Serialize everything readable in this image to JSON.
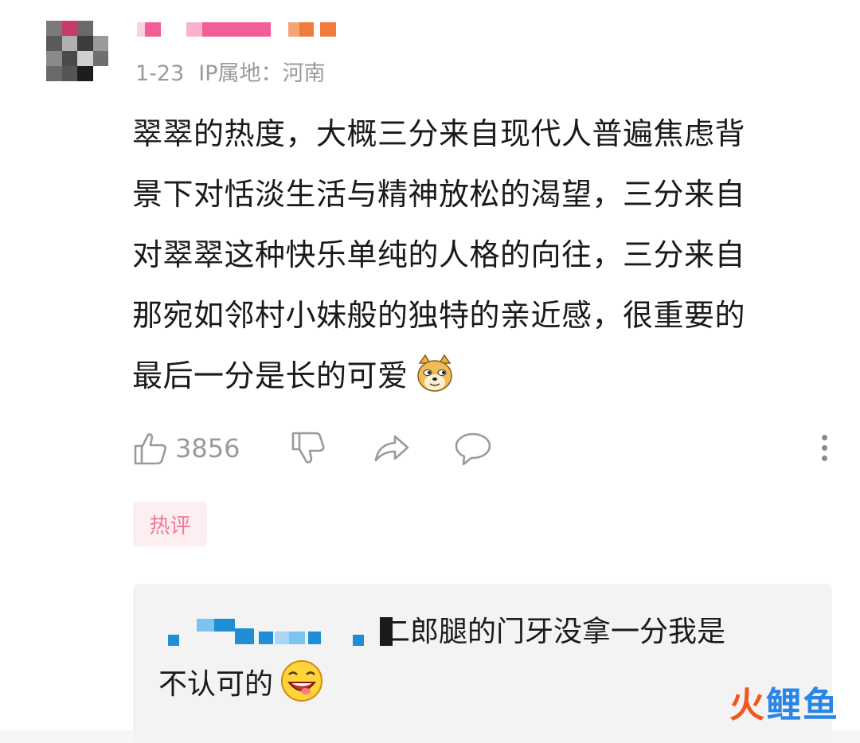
{
  "comment": {
    "date": "1-23",
    "ip_label": "IP属地：河南",
    "content_lines": [
      "翠翠的热度，大概三分来自现代人普遍焦虑背",
      "景下对恬淡生活与精神放松的渴望，三分来自",
      "对翠翠这种快乐单纯的人格的向往，三分来自",
      "那宛如邻村小妹般的独特的亲近感，很重要的",
      "最后一分是长的可爱"
    ],
    "emoji": "doge-emoji",
    "like_count": "3856",
    "tag": "热评"
  },
  "reply": {
    "text_line1": "二郎腿的门牙没拿一分我是",
    "text_line2": "不认可的",
    "emoji": "grinning-face-emoji"
  },
  "watermark": {
    "part1": "火",
    "part2": "鲤鱼"
  },
  "colors": {
    "meta_gray": "#9a9a9a",
    "tag_pink": "#f07a94",
    "tag_bg": "#fdeef1",
    "reply_bg": "#f3f3f3",
    "mosaic_pink": "#f25f96",
    "mosaic_orange": "#f07b3c",
    "mosaic_blue": "#1e8fd6"
  }
}
